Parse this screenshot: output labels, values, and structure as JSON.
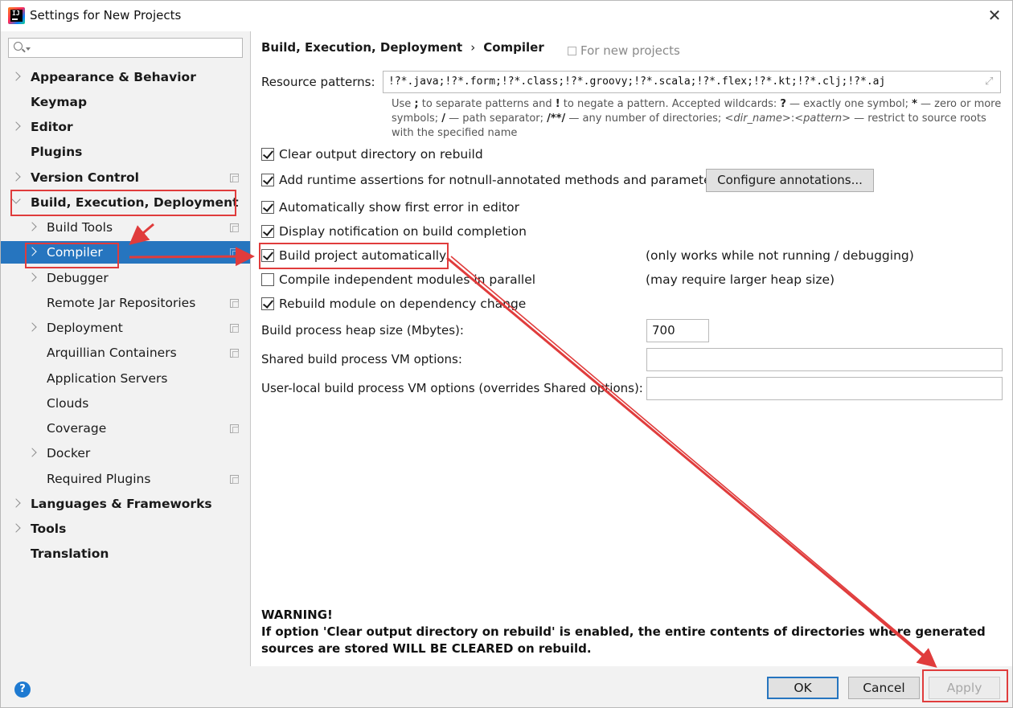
{
  "window": {
    "title": "Settings for New Projects"
  },
  "sidebar": {
    "search_placeholder": "",
    "items": [
      {
        "label": "Appearance & Behavior"
      },
      {
        "label": "Keymap"
      },
      {
        "label": "Editor"
      },
      {
        "label": "Plugins"
      },
      {
        "label": "Version Control"
      },
      {
        "label": "Build, Execution, Deployment"
      },
      {
        "label": "Build Tools"
      },
      {
        "label": "Compiler"
      },
      {
        "label": "Debugger"
      },
      {
        "label": "Remote Jar Repositories"
      },
      {
        "label": "Deployment"
      },
      {
        "label": "Arquillian Containers"
      },
      {
        "label": "Application Servers"
      },
      {
        "label": "Clouds"
      },
      {
        "label": "Coverage"
      },
      {
        "label": "Docker"
      },
      {
        "label": "Required Plugins"
      },
      {
        "label": "Languages & Frameworks"
      },
      {
        "label": "Tools"
      },
      {
        "label": "Translation"
      }
    ]
  },
  "main": {
    "breadcrumb": {
      "parent": "Build, Execution, Deployment",
      "separator": "›",
      "current": "Compiler"
    },
    "scope": "For new projects",
    "resource_patterns": {
      "label": "Resource patterns:",
      "value": "!?*.java;!?*.form;!?*.class;!?*.groovy;!?*.scala;!?*.flex;!?*.kt;!?*.clj;!?*.aj"
    },
    "options": [
      {
        "label": "Clear output directory on rebuild",
        "checked": true
      },
      {
        "label": "Add runtime assertions for notnull-annotated methods and parameters",
        "checked": true
      },
      {
        "label": "Automatically show first error in editor",
        "checked": true
      },
      {
        "label": "Display notification on build completion",
        "checked": true
      },
      {
        "label": "Build project automatically",
        "checked": true
      },
      {
        "label": "Compile independent modules in parallel",
        "checked": false
      },
      {
        "label": "Rebuild module on dependency change",
        "checked": true
      }
    ],
    "configure_annotations": "Configure annotations...",
    "notes": {
      "build_auto": "(only works while not running / debugging)",
      "parallel": "(may require larger heap size)"
    },
    "heap": {
      "label": "Build process heap size (Mbytes):",
      "value": "700"
    },
    "shared_vm": {
      "label": "Shared build process VM options:",
      "value": ""
    },
    "user_vm": {
      "label": "User-local build process VM options (overrides Shared options):",
      "value": ""
    },
    "warning": {
      "title": "WARNING!",
      "text": "If option 'Clear output directory on rebuild' is enabled, the entire contents of directories where generated sources are stored WILL BE CLEARED on rebuild."
    }
  },
  "footer": {
    "help": "?",
    "ok": "OK",
    "cancel": "Cancel",
    "apply": "Apply"
  },
  "colors": {
    "selection": "#2675bf",
    "annotation": "#e03c3c"
  }
}
